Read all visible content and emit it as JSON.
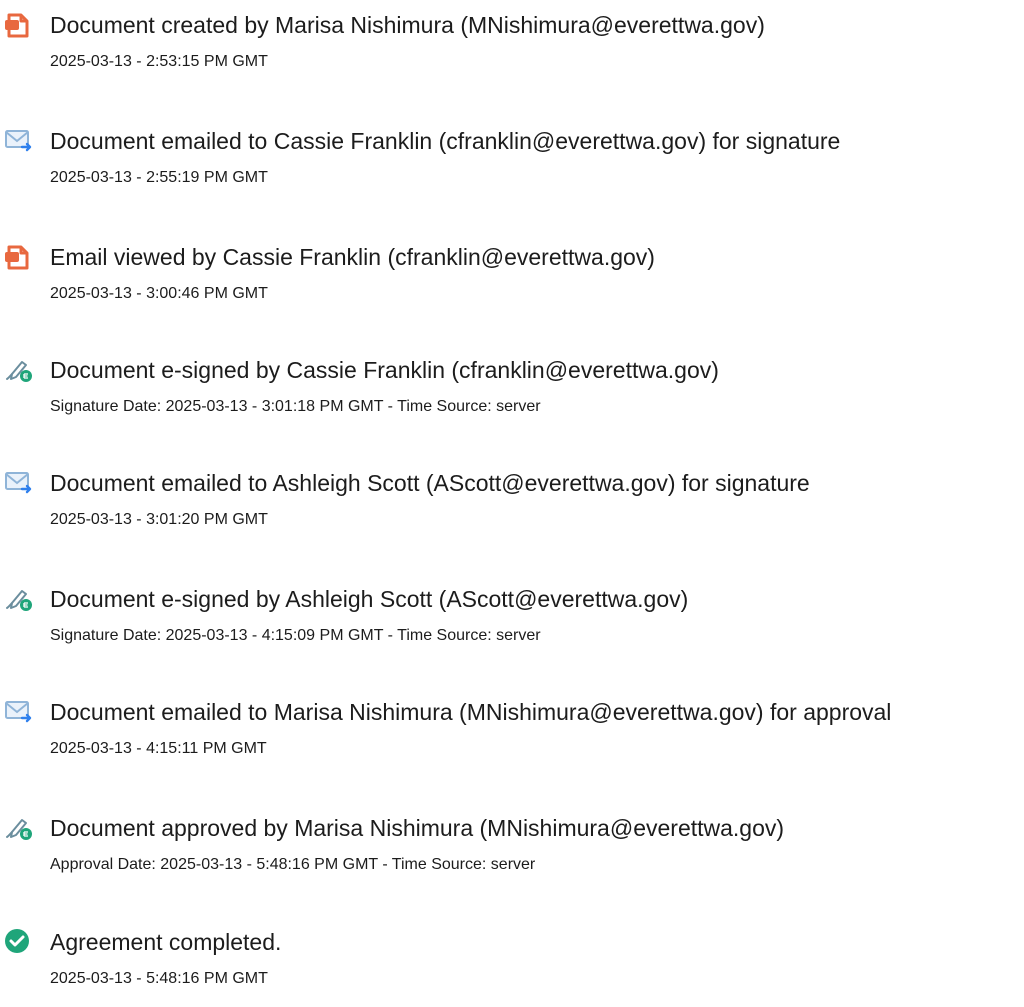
{
  "colors": {
    "doc_icon": "#e8683f",
    "email_icon": "#2f80ed",
    "email_frame": "#8fb4d8",
    "sign_pen": "#6b8e9e",
    "sign_badge": "#1fa57a",
    "complete_icon": "#1fa57a"
  },
  "events": [
    {
      "icon": "document-icon",
      "title": "Document created by Marisa Nishimura (MNishimura@everettwa.gov)",
      "detail": "2025-03-13 - 2:53:15 PM GMT"
    },
    {
      "icon": "email-icon",
      "title": "Document emailed to Cassie Franklin (cfranklin@everettwa.gov) for signature",
      "detail": "2025-03-13 - 2:55:19 PM GMT"
    },
    {
      "icon": "document-icon",
      "title": "Email viewed by Cassie Franklin (cfranklin@everettwa.gov)",
      "detail": "2025-03-13 - 3:00:46 PM GMT"
    },
    {
      "icon": "signature-icon",
      "title": "Document e-signed by Cassie Franklin (cfranklin@everettwa.gov)",
      "detail": "Signature Date: 2025-03-13 - 3:01:18 PM GMT - Time Source: server"
    },
    {
      "icon": "email-icon",
      "title": "Document emailed to Ashleigh Scott (AScott@everettwa.gov) for signature",
      "detail": "2025-03-13 - 3:01:20 PM GMT"
    },
    {
      "icon": "signature-icon",
      "title": "Document e-signed by Ashleigh Scott (AScott@everettwa.gov)",
      "detail": "Signature Date: 2025-03-13 - 4:15:09 PM GMT - Time Source: server"
    },
    {
      "icon": "email-icon",
      "title": "Document emailed to Marisa Nishimura (MNishimura@everettwa.gov) for approval",
      "detail": "2025-03-13 - 4:15:11 PM GMT"
    },
    {
      "icon": "signature-icon",
      "title": "Document approved by Marisa Nishimura (MNishimura@everettwa.gov)",
      "detail": "Approval Date: 2025-03-13 - 5:48:16 PM GMT - Time Source: server"
    },
    {
      "icon": "check-circle-icon",
      "title": "Agreement completed.",
      "detail": "2025-03-13 - 5:48:16 PM GMT"
    }
  ]
}
